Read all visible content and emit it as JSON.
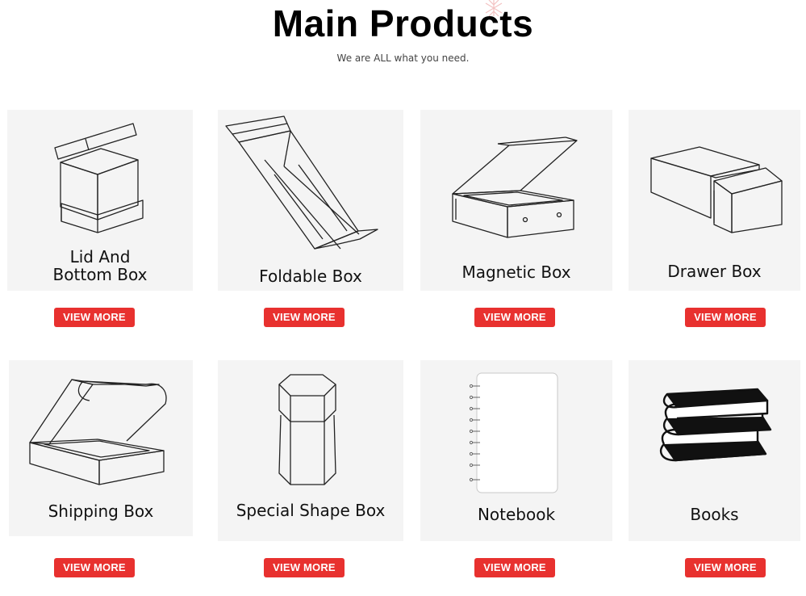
{
  "header": {
    "title": "Main Products",
    "subtitle": "We are ALL what you need."
  },
  "products": [
    {
      "label": "Lid And Bottom Box",
      "label_lines": [
        "Lid And",
        "Bottom Box"
      ],
      "icon": "lid-and-bottom-box-icon",
      "button": "VIEW MORE"
    },
    {
      "label": "Foldable Box",
      "icon": "foldable-box-icon",
      "button": "VIEW MORE"
    },
    {
      "label": "Magnetic Box",
      "icon": "magnetic-box-icon",
      "button": "VIEW MORE"
    },
    {
      "label": "Drawer Box",
      "icon": "drawer-box-icon",
      "button": "VIEW MORE"
    },
    {
      "label": "Shipping Box",
      "icon": "shipping-box-icon",
      "button": "VIEW MORE"
    },
    {
      "label": "Special Shape Box",
      "icon": "special-shape-box-icon",
      "button": "VIEW MORE"
    },
    {
      "label": "Notebook",
      "icon": "notebook-icon",
      "button": "VIEW MORE"
    },
    {
      "label": "Books",
      "icon": "books-icon",
      "button": "VIEW MORE"
    }
  ],
  "colors": {
    "button": "#e8312f",
    "card_bg": "#f4f4f4"
  }
}
